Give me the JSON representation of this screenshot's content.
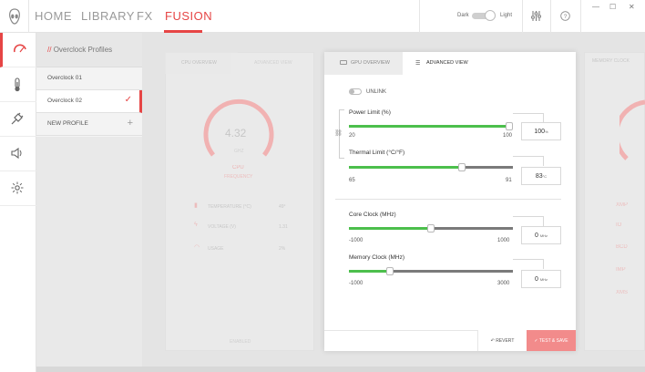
{
  "nav": {
    "home": "HOME",
    "library": "LIBRARY",
    "fx": "FX",
    "fusion": "FUSION"
  },
  "theme": {
    "dark": "Dark",
    "light": "Light"
  },
  "window": {
    "minimize": "—",
    "maximize": "☐",
    "close": "✕"
  },
  "rail": {
    "items": [
      {
        "icon": "overclock-icon"
      },
      {
        "icon": "thermometer-icon"
      },
      {
        "icon": "power-plug-icon"
      },
      {
        "icon": "speaker-icon"
      },
      {
        "icon": "brightness-icon"
      }
    ]
  },
  "profiles": {
    "title_prefix": "//",
    "title": "Overclock Profiles",
    "items": [
      {
        "label": "Overclock 01"
      },
      {
        "label": "Overclock 02",
        "mark": "✓"
      },
      {
        "label": "NEW PROFILE",
        "mark": "+"
      }
    ]
  },
  "cpu": {
    "tab1": "CPU OVERVIEW",
    "tab2": "ADVANCED VIEW",
    "gauge_value": "4.32",
    "gauge_unit": "GHZ",
    "gauge_label": "CPU",
    "gauge_label2": "FREQUENCY",
    "stats": [
      {
        "name": "TEMPERATURE (°C)",
        "value": "49°"
      },
      {
        "name": "VOLTAGE (V)",
        "value": "1.31"
      },
      {
        "name": "USAGE",
        "value": "2%"
      }
    ],
    "enable": "ENABLED"
  },
  "memory": {
    "tab": "MEMORY CLOCK",
    "icons": [
      "XMP",
      "IO",
      "BCD",
      "IMP",
      "XMS"
    ]
  },
  "gpu": {
    "tab_overview": "GPU OVERVIEW",
    "tab_advanced": "ADVANCED VIEW",
    "unlink": "UNLINK",
    "sliders": [
      {
        "label": "Power Limit (%)",
        "min": "20",
        "max": "100",
        "value": "100",
        "unit": "%",
        "fraction": 1.0
      },
      {
        "label": "Thermal Limit (°C/°F)",
        "min": "65",
        "max": "91",
        "value": "83",
        "unit": "°C",
        "fraction": 0.69
      },
      {
        "label": "Core Clock (MHz)",
        "min": "-1000",
        "max": "1000",
        "value": "0",
        "unit": "MHz",
        "fraction": 0.5
      },
      {
        "label": "Memory Clock (MHz)",
        "min": "-1000",
        "max": "3000",
        "value": "0",
        "unit": "MHz",
        "fraction": 0.25
      }
    ],
    "revert": "REVERT",
    "save": "TEST & SAVE"
  },
  "colors": {
    "accent": "#e64545",
    "slider_fill": "#4cbf4c",
    "save_button": "#f28b8b"
  }
}
